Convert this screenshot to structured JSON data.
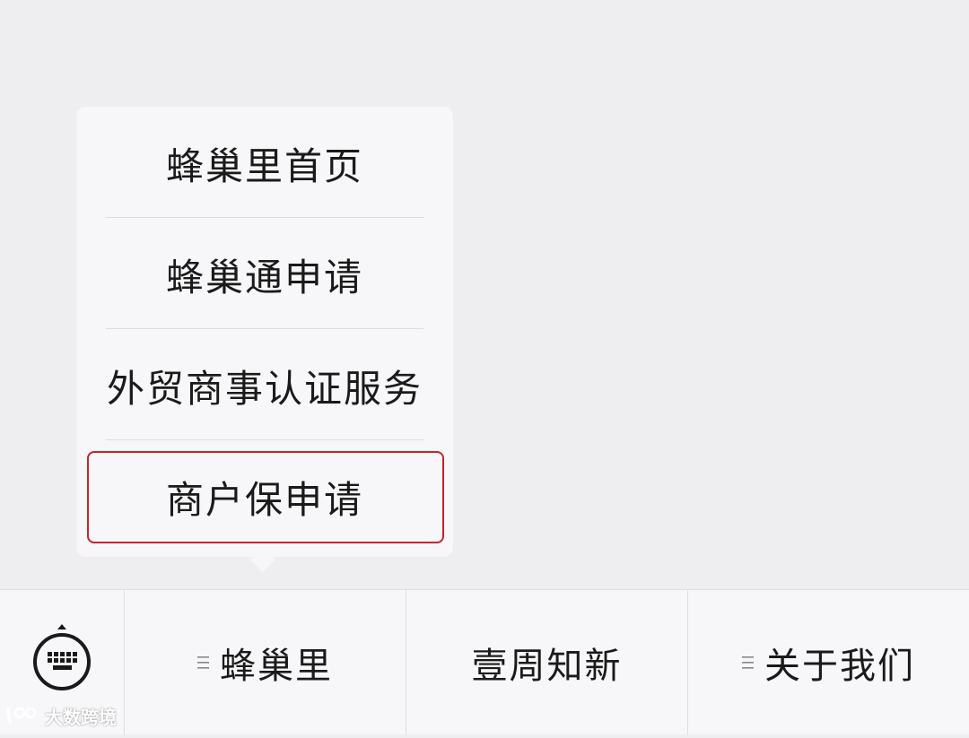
{
  "popup_menu": {
    "items": [
      {
        "label": "蜂巢里首页"
      },
      {
        "label": "蜂巢通申请"
      },
      {
        "label": "外贸商事认证服务"
      },
      {
        "label": "商户保申请"
      }
    ],
    "highlighted_item": "商户保申请",
    "highlight_color": "#c6232c"
  },
  "bottom_bar": {
    "keyboard_icon": "keyboard-icon",
    "tabs": [
      {
        "label": "蜂巢里",
        "icon": "menu-lines-icon"
      },
      {
        "label": "壹周知新"
      },
      {
        "label": "关于我们",
        "icon": "menu-lines-icon"
      }
    ]
  },
  "watermark": {
    "text": "大数跨境"
  },
  "colors": {
    "background": "#eeedef",
    "panel": "#f7f6f8",
    "text": "#1a1a1a"
  }
}
